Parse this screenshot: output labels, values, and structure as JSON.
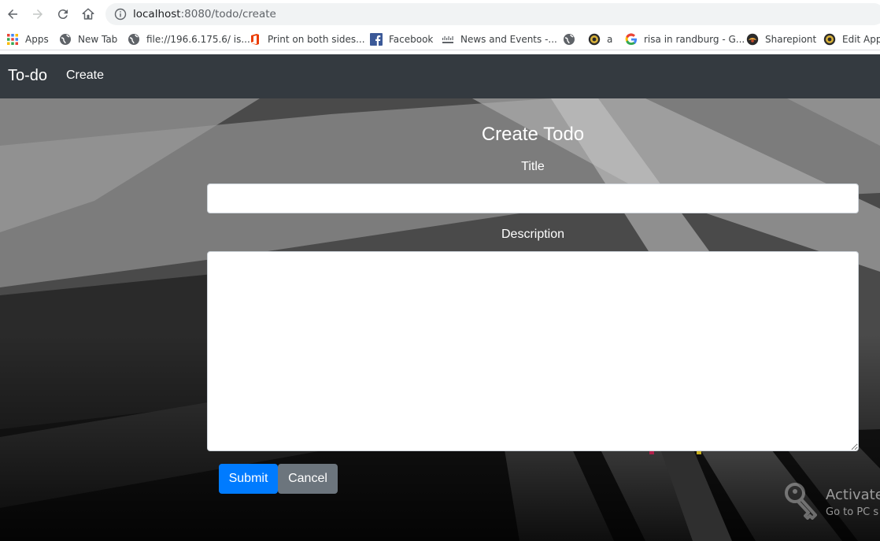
{
  "browser": {
    "url_host": "localhost",
    "url_path": ":8080/todo/create",
    "bookmarks": [
      {
        "label": "Apps",
        "icon": "apps-grid-icon"
      },
      {
        "label": "New Tab",
        "icon": "globe-icon"
      },
      {
        "label": "file://196.6.175.6/ is...",
        "icon": "globe-icon"
      },
      {
        "label": "Print on both sides...",
        "icon": "office-icon"
      },
      {
        "label": "Facebook",
        "icon": "facebook-icon"
      },
      {
        "label": "News and Events -...",
        "icon": "cisco-icon"
      },
      {
        "label": "",
        "icon": "globe-icon"
      },
      {
        "label": "a",
        "icon": "crest-icon"
      },
      {
        "label": "risa in randburg - G...",
        "icon": "google-icon"
      },
      {
        "label": "Sharepiont",
        "icon": "sharepoint-icon"
      },
      {
        "label": "Edit Appl",
        "icon": "crest-icon"
      }
    ]
  },
  "navbar": {
    "brand": "To-do",
    "link": "Create",
    "bg_color": "#343a40"
  },
  "form": {
    "heading": "Create Todo",
    "title_label": "Title",
    "title_value": "",
    "description_label": "Description",
    "description_value": "",
    "submit_label": "Submit",
    "cancel_label": "Cancel",
    "submit_color": "#007bff",
    "cancel_color": "#6c757d"
  },
  "watermark": {
    "line1": "Activate",
    "line2": "Go to PC s"
  }
}
